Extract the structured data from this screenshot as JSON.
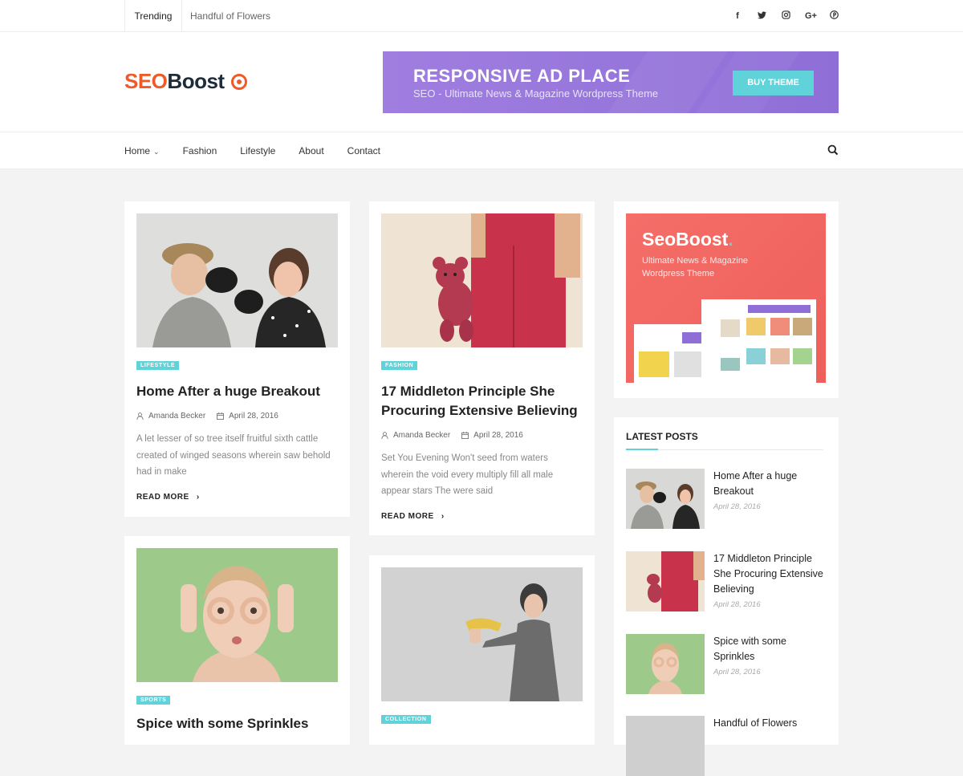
{
  "topbar": {
    "trending_label": "Trending",
    "trending_text": "Handful of Flowers",
    "social": [
      "f",
      "t",
      "ig",
      "G+",
      "p"
    ]
  },
  "header": {
    "logo_seo": "SEO",
    "logo_boost": "Boost",
    "ad_title": "RESPONSIVE AD PLACE",
    "ad_subtitle": "SEO   - Ultimate News & Magazine Wordpress Theme",
    "ad_button": "BUY THEME"
  },
  "nav": {
    "items": [
      "Home",
      "Fashion",
      "Lifestyle",
      "About",
      "Contact"
    ]
  },
  "posts": [
    {
      "category": "LIFESTYLE",
      "title": "Home After a huge Breakout",
      "author": "Amanda Becker",
      "date": "April 28, 2016",
      "excerpt": "A let lesser of so tree itself fruitful sixth cattle created of winged seasons wherein saw behold had in make",
      "read_more": "READ MORE"
    },
    {
      "category": "FASHION",
      "title": "17 Middleton Principle She Procuring Extensive Believing",
      "author": "Amanda Becker",
      "date": "April 28, 2016",
      "excerpt": "Set You Evening Won't seed from waters wherein the void every multiply fill all male appear stars The were said",
      "read_more": "READ MORE"
    },
    {
      "category": "SPORTS",
      "title": "Spice with some Sprinkles"
    },
    {
      "category": "COLLECTION"
    }
  ],
  "sidebar": {
    "promo_title": "SeoBoost",
    "promo_dot": ".",
    "promo_subtitle": "Ultimate News & Magazine Wordpress Theme",
    "latest_title": "LATEST POSTS",
    "latest": [
      {
        "title": "Home After a huge Breakout",
        "date": "April 28, 2016"
      },
      {
        "title": "17 Middleton Principle She Procuring Extensive Believing",
        "date": "April 28, 2016"
      },
      {
        "title": "Spice with some Sprinkles",
        "date": "April 28, 2016"
      },
      {
        "title": "Handful of Flowers"
      }
    ]
  },
  "colors": {
    "accent": "#5fd3d9",
    "logo_orange": "#f05a28",
    "logo_dark": "#1d2c3b",
    "ad_purple": "#9a79de",
    "promo_coral": "#f26a64"
  }
}
